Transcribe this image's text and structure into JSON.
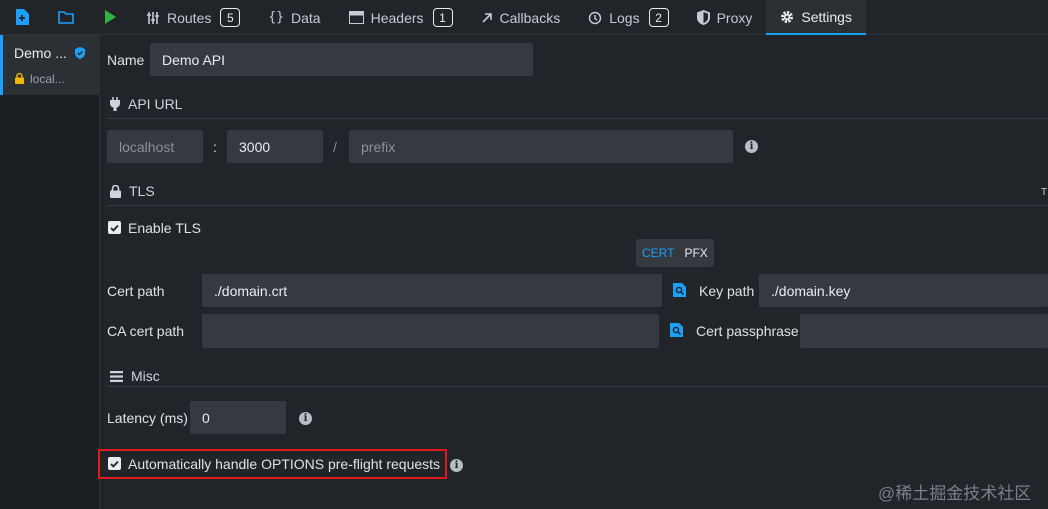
{
  "topbar": {
    "tabs": [
      {
        "label": "Routes",
        "badge": "5"
      },
      {
        "label": "Data"
      },
      {
        "label": "Headers",
        "badge": "1"
      },
      {
        "label": "Callbacks"
      },
      {
        "label": "Logs",
        "badge": "2"
      },
      {
        "label": "Proxy"
      },
      {
        "label": "Settings"
      }
    ],
    "active_tab": "Settings"
  },
  "sidebar": {
    "environment": {
      "name": "Demo ...",
      "host": "local..."
    }
  },
  "settings": {
    "name_label": "Name",
    "name_value": "Demo API",
    "api_url": {
      "title": "API URL",
      "host": "localhost",
      "colon": ":",
      "port": "3000",
      "slash": "/",
      "prefix_placeholder": "prefix"
    },
    "tls": {
      "title": "TLS",
      "enable_label": "Enable TLS",
      "enabled": true,
      "toggle": [
        "CERT",
        "PFX"
      ],
      "toggle_selected": "CERT",
      "cert_path_label": "Cert path",
      "cert_path_value": "./domain.crt",
      "key_path_label": "Key path",
      "key_path_value": "./domain.key",
      "ca_cert_label": "CA cert path",
      "ca_cert_value": "",
      "passphrase_label": "Cert passphrase",
      "passphrase_value": "",
      "edge_glyph": "T"
    },
    "misc": {
      "title": "Misc",
      "latency_label": "Latency (ms)",
      "latency_value": "0",
      "options_label": "Automatically handle OPTIONS pre-flight requests",
      "options_checked": true
    }
  },
  "watermark": "@稀土掘金技术社区",
  "colors": {
    "accent": "#1c9ff7",
    "highlight": "#e01b1b",
    "background": "#212529",
    "field": "#353a40"
  }
}
